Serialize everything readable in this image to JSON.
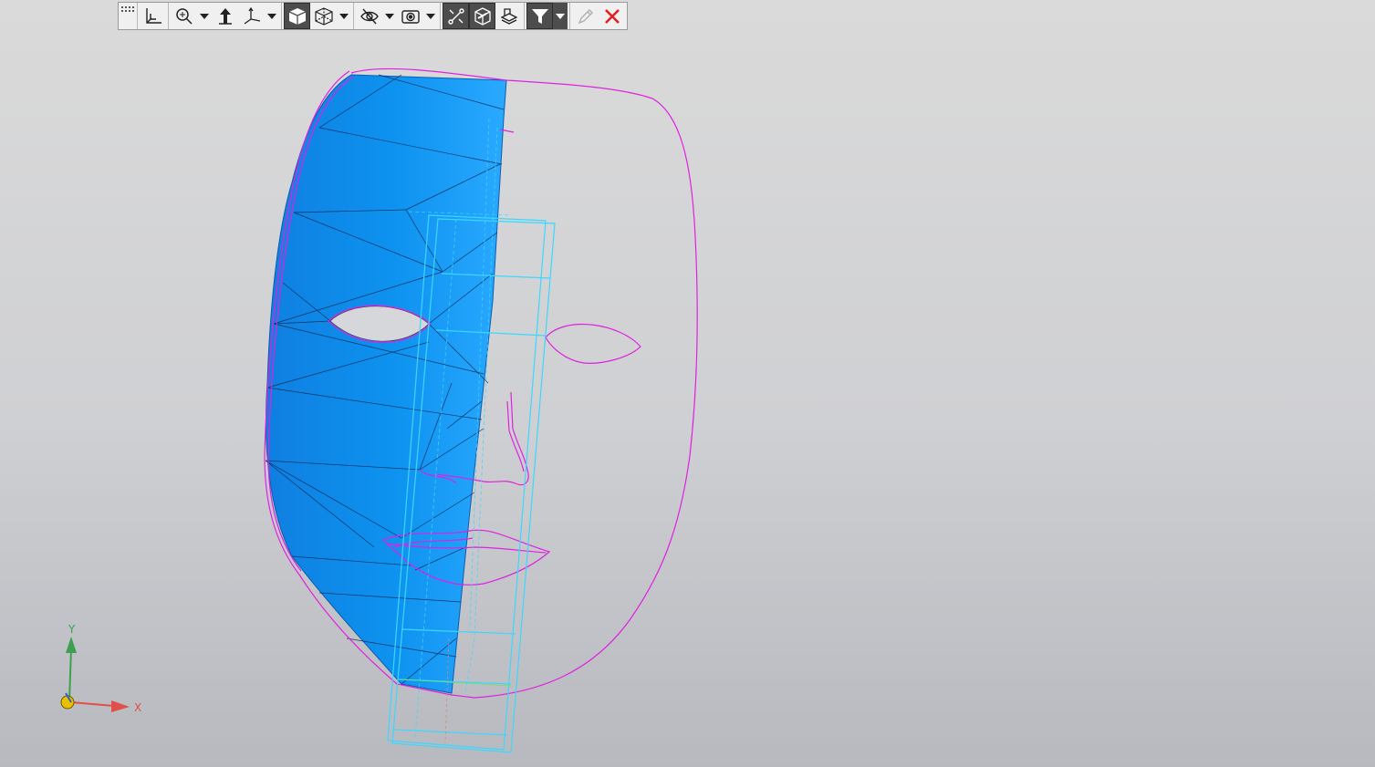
{
  "toolbar": {
    "buttons": [
      {
        "name": "toolbar-grip",
        "icon": "grip-dots-icon"
      },
      {
        "name": "normal-to-button",
        "icon": "normal-to-icon"
      },
      {
        "name": "zoom-button",
        "icon": "magnifier-icon"
      },
      {
        "name": "orientation-button",
        "icon": "orientation-icon"
      },
      {
        "name": "coordinate-system-button",
        "icon": "axes-icon"
      },
      {
        "name": "shaded-display-button",
        "icon": "shaded-cube-icon",
        "active": true
      },
      {
        "name": "wireframe-display-button",
        "icon": "wireframe-cube-icon"
      },
      {
        "name": "hide-button",
        "icon": "eye-crossed-icon"
      },
      {
        "name": "visibility-button",
        "icon": "camera-eye-icon"
      },
      {
        "name": "show-constraints-button",
        "icon": "constraint-icon",
        "active": true
      },
      {
        "name": "section-view-button",
        "icon": "section-view-icon",
        "active": true
      },
      {
        "name": "layers-button",
        "icon": "layers-icon"
      },
      {
        "name": "filter-button",
        "icon": "filter-icon",
        "active": true
      },
      {
        "name": "pencil-button",
        "icon": "pencil-icon",
        "disabled": true
      },
      {
        "name": "close-button",
        "icon": "close-icon",
        "color": "#e02020"
      }
    ]
  },
  "triad": {
    "x_label": "X",
    "y_label": "Y",
    "x_color": "#e0504a",
    "y_color": "#3ca050",
    "origin_color": "#e8c000"
  },
  "colors": {
    "surface": "#0e93f0",
    "surface_light": "#35b2ff",
    "sketch": "#e020e0",
    "guide": "#3cd7ff"
  }
}
